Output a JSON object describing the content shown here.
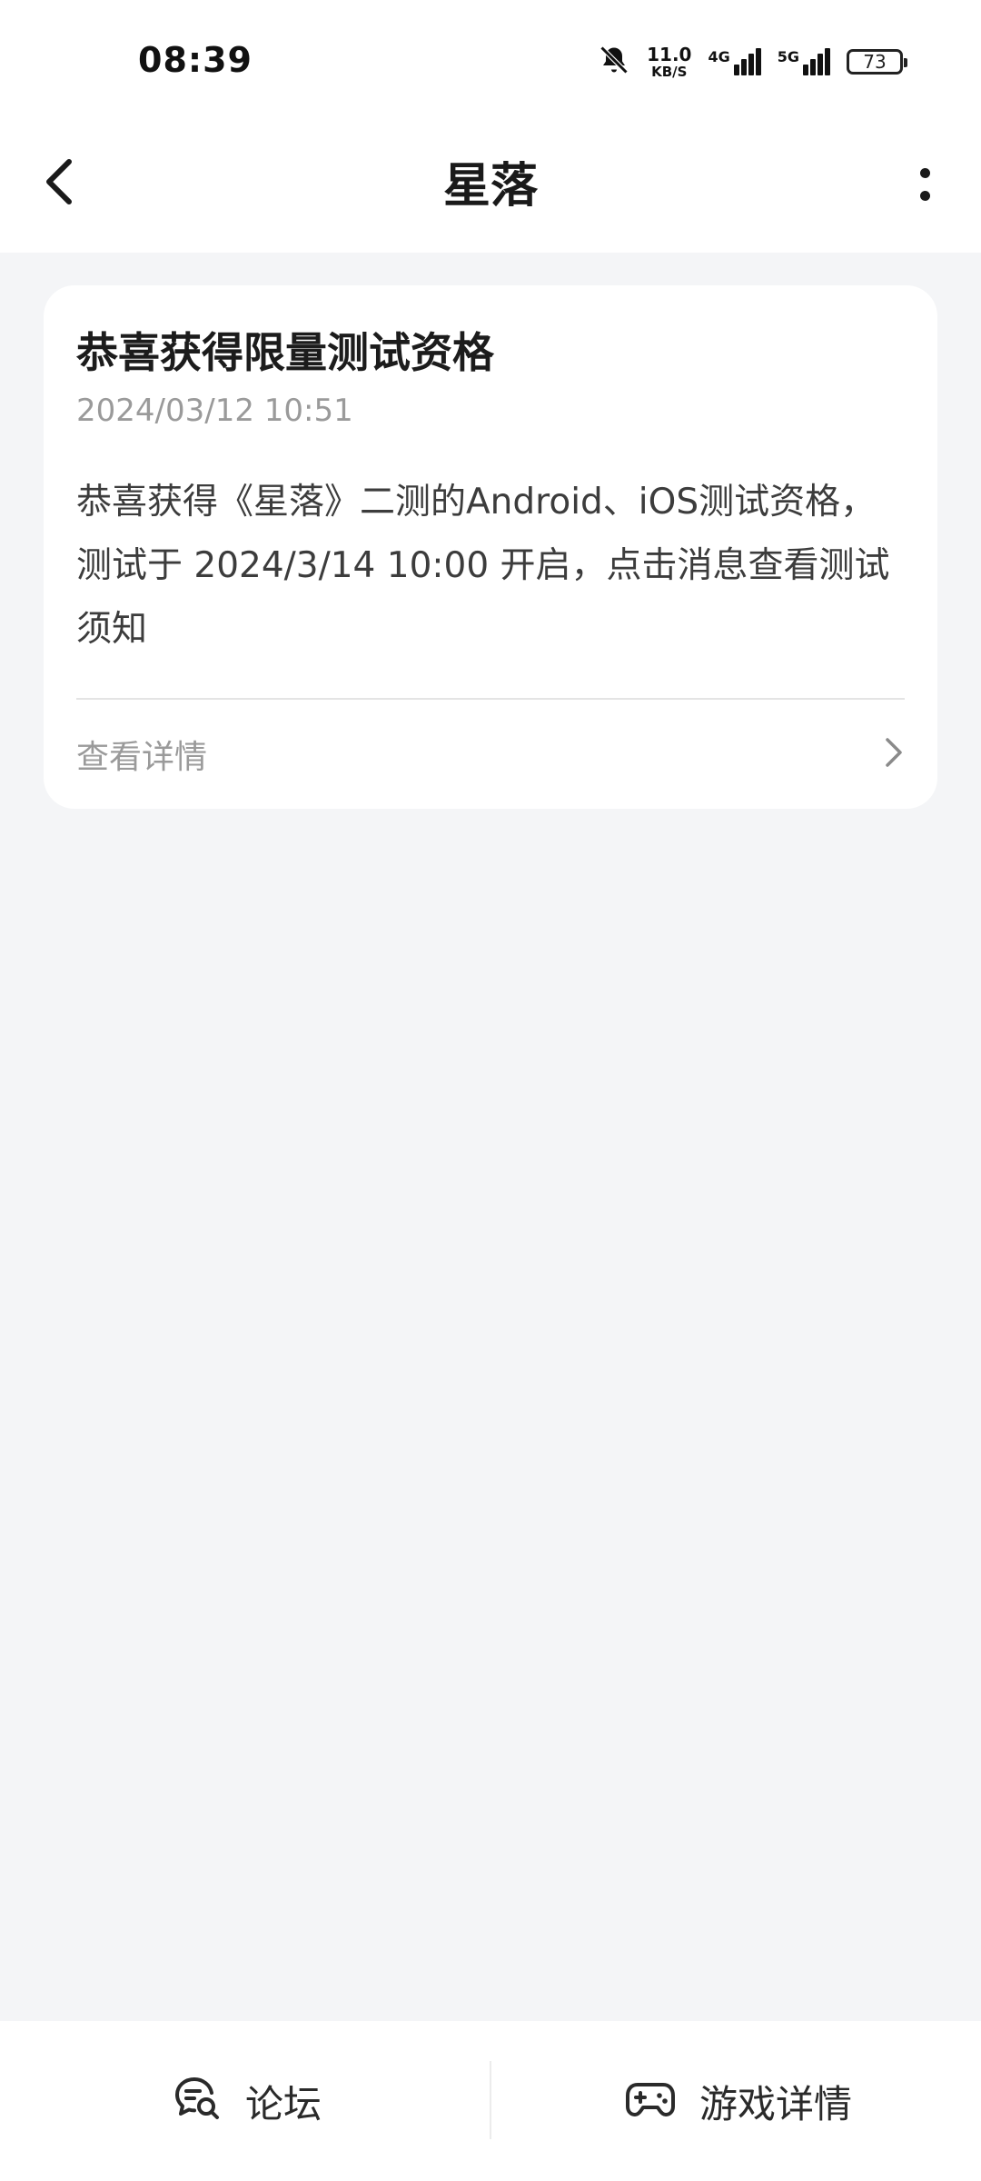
{
  "status_bar": {
    "time": "08:39",
    "net_speed_value": "11.0",
    "net_speed_unit": "KB/S",
    "signal_1_label": "4G",
    "signal_2_label": "5G",
    "battery_level": "73",
    "icons": [
      "bell-off-icon",
      "signal-icon",
      "battery-icon"
    ]
  },
  "header": {
    "title": "星落",
    "icons": [
      "back-arrow-icon",
      "more-vertical-icon"
    ]
  },
  "message_card": {
    "title": "恭喜获得限量测试资格",
    "timestamp": "2024/03/12 10:51",
    "body": "恭喜获得《星落》二测的Android、iOS测试资格，测试于 2024/3/14 10:00 开启，点击消息查看测试须知",
    "action_label": "查看详情",
    "action_icon": "chevron-right-icon"
  },
  "bottom_nav": {
    "forum_label": "论坛",
    "forum_icon": "chat-search-icon",
    "game_label": "游戏详情",
    "game_icon": "gamepad-icon"
  }
}
